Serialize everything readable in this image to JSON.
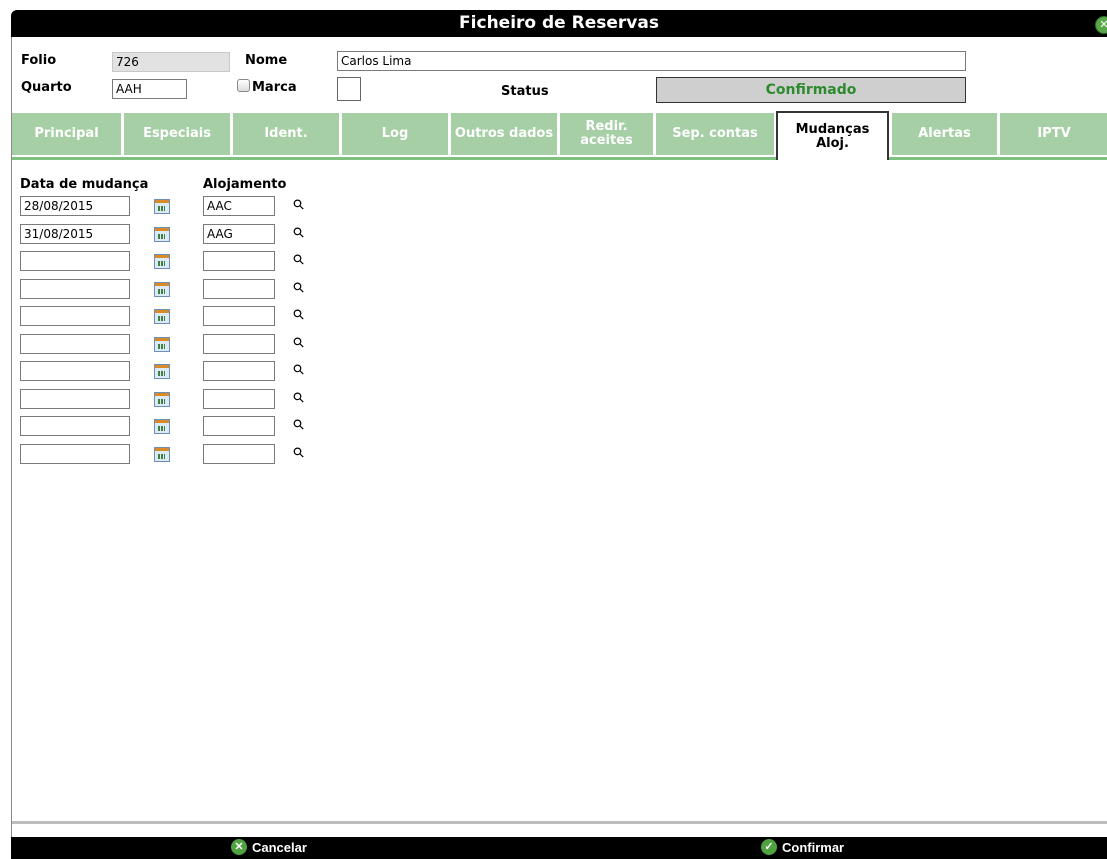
{
  "window": {
    "title": "Ficheiro de Reservas",
    "close_icon": "close-icon"
  },
  "form": {
    "folio_label": "Folio",
    "folio_value": "726",
    "nome_label": "Nome",
    "nome_value": "Carlos Lima",
    "quarto_label": "Quarto",
    "quarto_value": "AAH",
    "marca_label": "Marca",
    "status_label": "Status",
    "status_value": "Confirmado"
  },
  "tabs": [
    {
      "label": "Principal"
    },
    {
      "label": "Especiais"
    },
    {
      "label": "Ident."
    },
    {
      "label": "Log"
    },
    {
      "label": "Outros dados"
    },
    {
      "label": "Redir. aceites"
    },
    {
      "label": "Sep. contas"
    },
    {
      "label": "Mudanças Aloj."
    },
    {
      "label": "Alertas"
    },
    {
      "label": "IPTV"
    }
  ],
  "active_tab": "Mudanças Aloj.",
  "mudancas": {
    "col_date": "Data de mudança",
    "col_alojamento": "Alojamento",
    "rows": [
      {
        "date": "28/08/2015",
        "alojamento": "AAC"
      },
      {
        "date": "31/08/2015",
        "alojamento": "AAG"
      },
      {
        "date": "",
        "alojamento": ""
      },
      {
        "date": "",
        "alojamento": ""
      },
      {
        "date": "",
        "alojamento": ""
      },
      {
        "date": "",
        "alojamento": ""
      },
      {
        "date": "",
        "alojamento": ""
      },
      {
        "date": "",
        "alojamento": ""
      },
      {
        "date": "",
        "alojamento": ""
      },
      {
        "date": "",
        "alojamento": ""
      }
    ]
  },
  "footer": {
    "cancel_label": "Cancelar",
    "confirm_label": "Confirmar"
  },
  "colors": {
    "tab_bg": "#a6cfa6",
    "status_text": "#2d8a2d",
    "title_bg": "#000000"
  }
}
